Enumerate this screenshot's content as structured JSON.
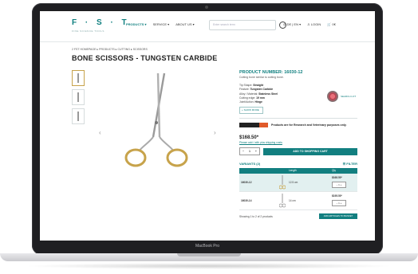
{
  "device": {
    "brand_plate": "MacBook Pro"
  },
  "header": {
    "logo": "F · S · T",
    "logo_sub": "FINE SCIENCE TOOLS",
    "nav": [
      "PRODUCTS ▾",
      "SERVICE ▾",
      "ABOUT US ▾"
    ],
    "search_placeholder": "Enter search term",
    "right": [
      "◎ DE | EN ▾",
      "♙ LOGIN",
      "🛒 0€"
    ]
  },
  "breadcrumb": "2 FST HOMEPAGE  ▸  PRODUCTS  ▸  CUTTING  ▸  SCISSORS",
  "title": "BONE SCISSORS - TUNGSTEN CARBIDE",
  "product": {
    "number": "PRODUCT NUMBER: 16030-12",
    "desc": "Cutting bone similar to cutting bone.",
    "specs": [
      {
        "k": "Tip Shape:",
        "v": "Straight"
      },
      {
        "k": "Feature:",
        "v": "Tungsten Carbide"
      },
      {
        "k": "Alloy / Material:",
        "v": "Stainless Steel"
      },
      {
        "k": "Cutting edge:",
        "v": "19 mm"
      },
      {
        "k": "Joint/Action:",
        "v": "Hinge"
      }
    ],
    "badge_label": "SEARCH LOT",
    "more_label": "+ SHOW MORE",
    "research_text": "Products are for Research and Veterinary purposes only.",
    "price": "$168.50*",
    "price_link": "Please add / with plus shipping costs",
    "qty": {
      "minus": "−",
      "value": "1",
      "plus": "+"
    },
    "cart_label": "ADD TO SHOPPING CART"
  },
  "variants": {
    "title": "VARIANTS (2)",
    "filter": "☰ FILTER",
    "headers": [
      "",
      "Length",
      "Qty"
    ],
    "rows": [
      {
        "id": "16030-12",
        "length": "12.5 cm",
        "price": "$168.50*",
        "qty": "−  1  +"
      },
      {
        "id": "16030-14",
        "length": "14 cm",
        "price": "$195.50*",
        "qty": "−  1  +"
      }
    ]
  },
  "footer": {
    "showing": "Showing 1 to 2 of 2 products",
    "button": "ADD ARTICLES TO BASKET"
  },
  "colors": {
    "accent": "#127f80",
    "gold": "#c7a34b"
  }
}
